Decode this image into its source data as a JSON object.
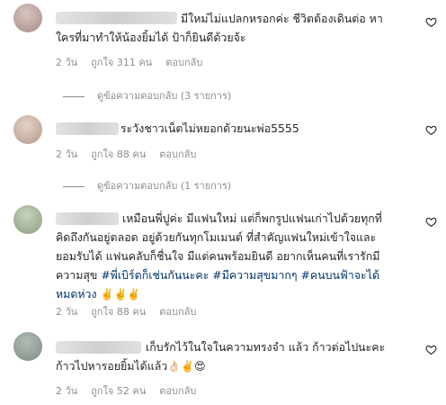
{
  "comments": [
    {
      "lines": [
        "มีใหม่ไม่แปลกหรอกค่ะ ชีวิตต้องเดินต่อ หา",
        "ใครที่มาทำให้น้องยิ้มได้ ป้าก็ยินดีด้วยจ้ะ"
      ],
      "time": "2 วัน",
      "likes": "ถูกใจ 311 คน",
      "reply": "ตอบกลับ",
      "view_replies": "ดูข้อความตอบกลับ (3 รายการ)",
      "avatar_color": "#b9a7a3"
    },
    {
      "lines": [
        "ระวังชาวเน็ตไม่หยอกด้วยนะพ่อ5555"
      ],
      "time": "2 วัน",
      "likes": "ถูกใจ 88 คน",
      "reply": "ตอบกลับ",
      "view_replies": "ดูข้อความตอบกลับ (1 รายการ)",
      "avatar_color": "#c9b2a6"
    },
    {
      "lines": [
        "เหมือนพี่ปูค่ะ มีแฟนใหม่ แต่ก็พกรูปแฟนเก่าไปด้วยทุกที่",
        "คิดถึงกันอยู่ตลอด อยู่ด้วยกันทุกโมเมนต์ ที่สำคัญแฟนใหม่เข้าใจและ",
        "ยอมรับได้ แฟนคลับก็ชื่นใจ มีแต่คนพร้อมยินดี อยากเห็นคนที่เรารักมี",
        "ความสุข"
      ],
      "tags": "#พี่เบิร์ดก็เช่นกันนะคะ #มีความสุขมากๆ #คนบนฟ้าจะได้",
      "tags2": "หมดห่วง",
      "tag_emoji": "✌️✌️✌️",
      "time": "2 วัน",
      "likes": "ถูกใจ 88 คน",
      "reply": "ตอบกลับ",
      "avatar_color": "#a7b59c"
    },
    {
      "lines": [
        "เก็บรักไว้ในใจในความทรงจำ แล้ว ก้าวต่อไปนะคะ",
        "ก้าวไปหารอยยิ้มได้แล้ว"
      ],
      "end_emoji": "👌🏻✌️😍",
      "time": "2 วัน",
      "likes": "ถูกใจ 52 คน",
      "reply": "ตอบกลับ",
      "avatar_color": "#8f9b92"
    }
  ],
  "icons": {
    "like": "heart-outline-icon"
  }
}
